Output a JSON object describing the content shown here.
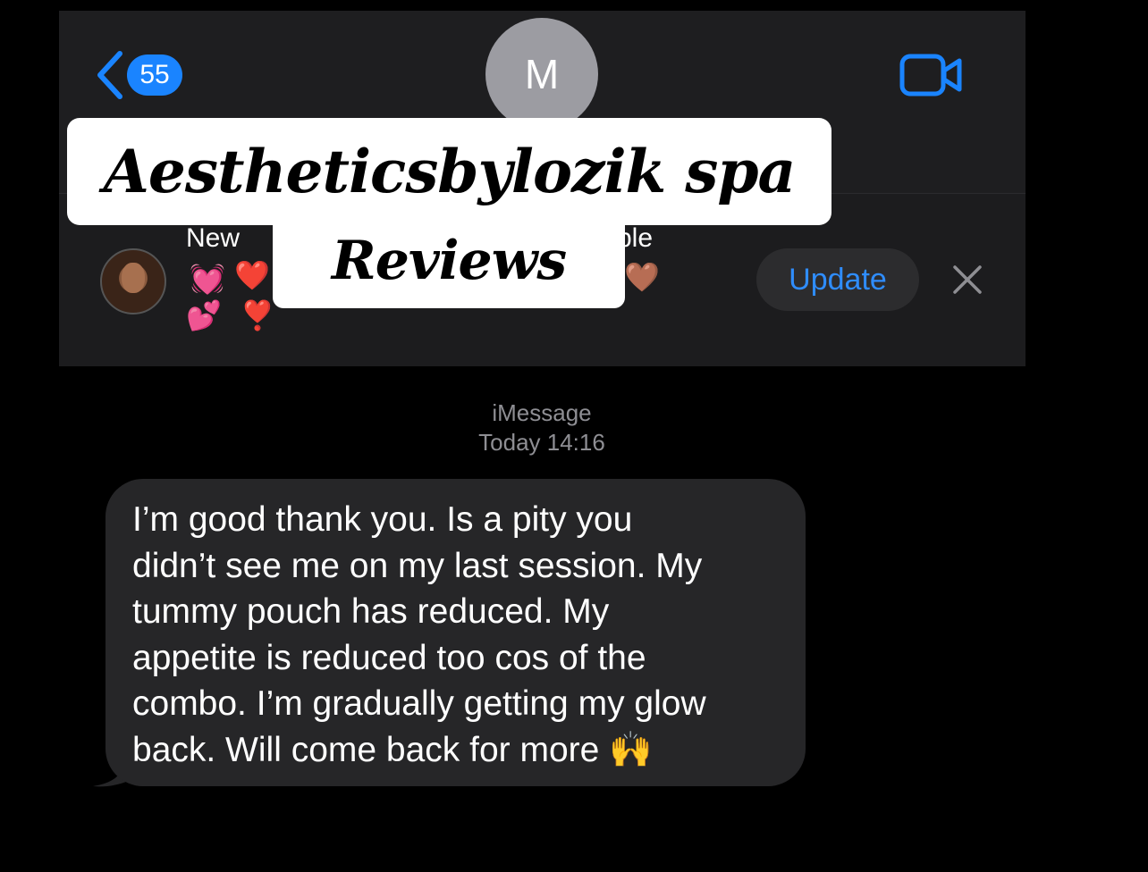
{
  "nav": {
    "back_badge": "55",
    "contact_initial": "M"
  },
  "share_banner": {
    "title_left": "New",
    "title_right": "ble",
    "update_label": "Update"
  },
  "overlay": {
    "title": "Aestheticsbylozik spa",
    "subtitle": "Reviews"
  },
  "conversation": {
    "service": "iMessage",
    "timestamp": "Today 14:16",
    "message_lines": [
      "I’m good thank you. Is a pity you",
      "didn’t see me on my last session. My",
      "tummy pouch has reduced. My",
      "appetite is reduced too cos of the",
      "combo. I’m gradually getting my glow",
      "back. Will come back for more 🙌"
    ]
  },
  "colors": {
    "accent": "#1a84ff",
    "background": "#000000",
    "bubble": "#262628",
    "header": "#1c1c1e"
  },
  "icons": [
    "chevron-left-icon",
    "video-camera-icon",
    "close-icon"
  ]
}
